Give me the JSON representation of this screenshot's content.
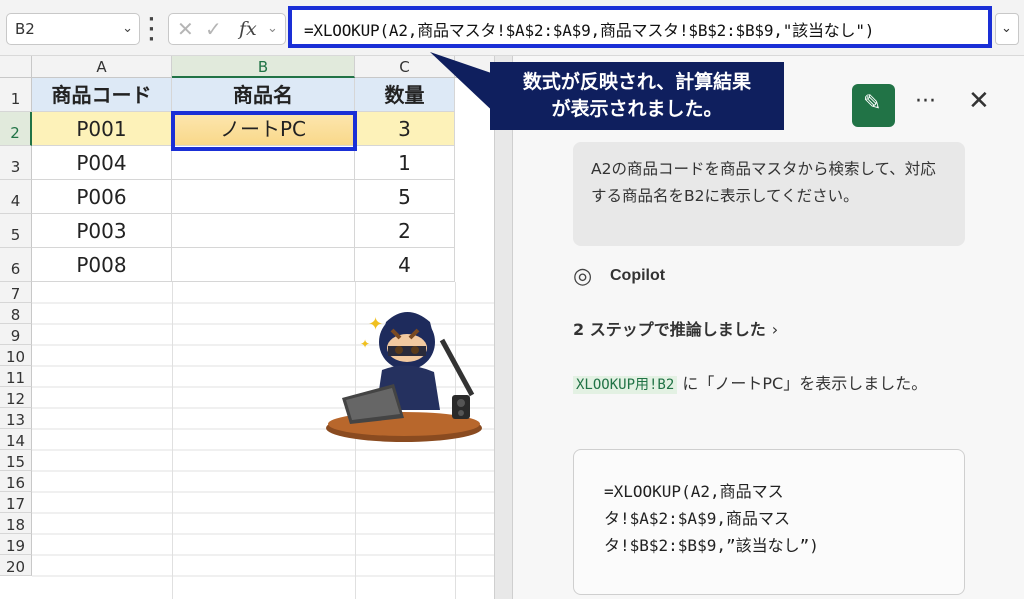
{
  "formula_bar": {
    "name_box": "B2",
    "formula": "=XLOOKUP(A2,商品マスタ!$A$2:$A$9,商品マスタ!$B$2:$B$9,\"該当なし\")",
    "fx_label": "fx"
  },
  "grid": {
    "columns": [
      "A",
      "B",
      "C"
    ],
    "rows": [
      "1",
      "2",
      "3",
      "4",
      "5",
      "6",
      "7",
      "8",
      "9",
      "10",
      "11",
      "12",
      "13",
      "14",
      "15",
      "16",
      "17",
      "18",
      "19",
      "20"
    ],
    "header": {
      "a": "商品コード",
      "b": "商品名",
      "c": "数量"
    },
    "data": [
      {
        "a": "P001",
        "b": "ノートPC",
        "c": "3"
      },
      {
        "a": "P004",
        "b": "",
        "c": "1"
      },
      {
        "a": "P006",
        "b": "",
        "c": "5"
      },
      {
        "a": "P003",
        "b": "",
        "c": "2"
      },
      {
        "a": "P008",
        "b": "",
        "c": "4"
      }
    ]
  },
  "callout": {
    "line1": "数式が反映され、計算結果",
    "line2": "が表示されました。"
  },
  "copilot": {
    "user_message": "A2の商品コードを商品マスタから検索して、対応する商品名をB2に表示してください。",
    "assistant_name": "Copilot",
    "steps_text": "2 ステップで推論しました",
    "answer_code": "XLOOKUP用!B2",
    "answer_pre": "",
    "answer_post": " に「ノートPC」を表示しました。",
    "code_lines": [
      "=XLOOKUP(A2,商品マス",
      "タ!$A$2:$A$9,商品マス",
      "タ!$B$2:$B$9,”該当なし”)"
    ]
  },
  "colors": {
    "accent_blue": "#1a2fd6",
    "excel_green": "#217346",
    "callout_navy": "#0f1f5e",
    "header_fill": "#dde9f6",
    "row_highlight": "#fdf2b9"
  }
}
